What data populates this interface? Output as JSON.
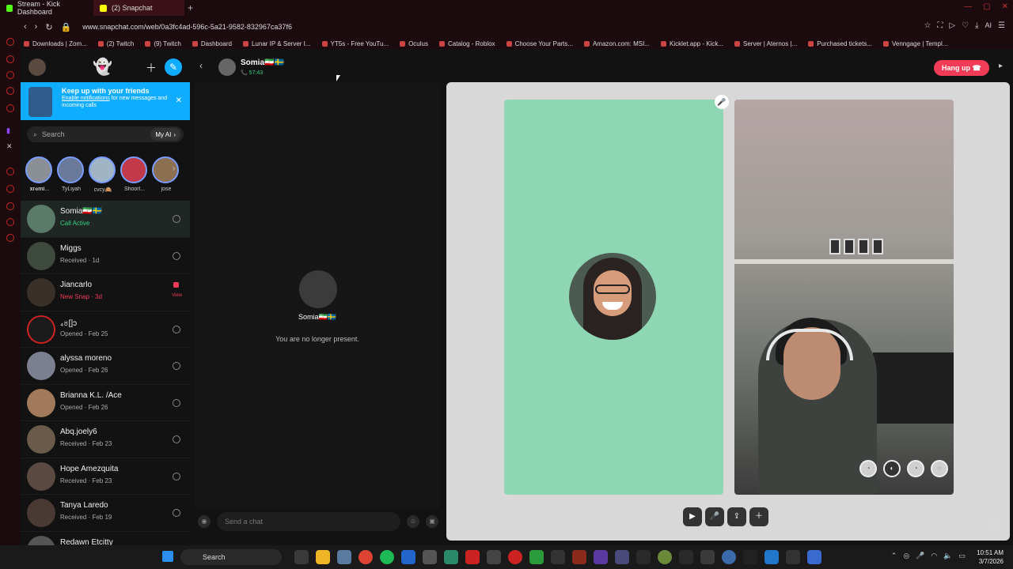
{
  "browser": {
    "tabs": [
      {
        "label": "Stream - Kick Dashboard",
        "color": "#53fc18"
      },
      {
        "label": "(2) Snapchat",
        "color": "#fffc00"
      }
    ],
    "new_tab": "+",
    "url": "www.snapchat.com/web/0a3fc4ad-596c-5a21-9582-832967ca37f6",
    "ai_label": "AI",
    "bookmarks": [
      "Downloads | Zom...",
      "(2) Twitch",
      "(9) Twitch",
      "Dashboard",
      "Lunar IP & Server I...",
      "YT5s - Free YouTu...",
      "Oculus",
      "Catalog - Roblox",
      "Choose Your Parts...",
      "Amazon.com: MSI...",
      "Kicklet.app - Kick...",
      "Server | Aternos |...",
      "Purchased tickets...",
      "Venngage | Templ..."
    ]
  },
  "sidebar": {
    "notify_title": "Keep up with your friends",
    "notify_link": "Enable notifications",
    "notify_text": "for new messages and incoming calls",
    "search_placeholder": "Search",
    "my_ai": "My AI",
    "stories": [
      "𝐱𝐫𝐞𝐦𝐢...",
      "TyLiyah",
      "cvcy🙈",
      "Shoorl...",
      "jose"
    ],
    "conversations": [
      {
        "name": "Somia🇮🇷🇸🇪",
        "status": "Call Active",
        "kind": "green"
      },
      {
        "name": "Miggs",
        "status": "Received · 1d",
        "kind": ""
      },
      {
        "name": "Jiancarlo",
        "status": "New Snap · 3d",
        "kind": "red",
        "view": "View"
      },
      {
        "name": "₄৪[]ɔ",
        "status": "Opened · Feb 25",
        "kind": ""
      },
      {
        "name": "alyssa moreno",
        "status": "Opened · Feb 26",
        "kind": ""
      },
      {
        "name": "Brianna K.L. /Ace",
        "status": "Opened · Feb 26",
        "kind": ""
      },
      {
        "name": "Abq.joely6",
        "status": "Received · Feb 23",
        "kind": ""
      },
      {
        "name": "Hope Amezquita",
        "status": "Received · Feb 23",
        "kind": ""
      },
      {
        "name": "Tanya Laredo",
        "status": "Received · Feb 19",
        "kind": ""
      },
      {
        "name": "Redawn Etcitty",
        "status": "",
        "kind": ""
      }
    ]
  },
  "chat": {
    "name": "Somia🇮🇷🇸🇪",
    "call_time": "57:43",
    "center_name": "Somia🇮🇷🇸🇪",
    "message": "You are no longer present.",
    "composer_placeholder": "Send a chat"
  },
  "call": {
    "hangup": "Hang up"
  },
  "taskbar": {
    "search": "Search",
    "time": "10:51 AM",
    "date": "3/7/2026"
  },
  "colors": {
    "accent": "#0fadff",
    "hangup": "#f23c57",
    "active": "#35d07f",
    "tile": "#8fd6b4"
  }
}
